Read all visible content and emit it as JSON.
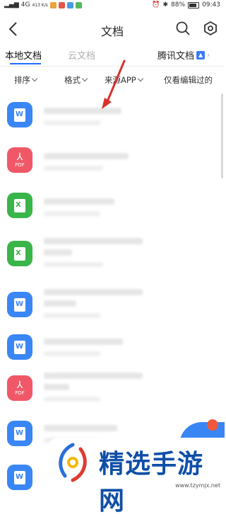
{
  "status_bar": {
    "signal_left": "4G",
    "network_speed": "413 K/s",
    "battery": "88%",
    "time": "09:43"
  },
  "header": {
    "title": "文档",
    "back_icon": "back-chevron-icon",
    "search_icon": "search-icon",
    "settings_icon": "settings-hex-icon"
  },
  "tabs": [
    {
      "label": "本地文档",
      "active": true
    },
    {
      "label": "云文档",
      "active": false
    },
    {
      "label": "腾讯文档",
      "active": false,
      "badge_icon": "tencent-docs-icon"
    }
  ],
  "filters": [
    {
      "label": "排序"
    },
    {
      "label": "格式"
    },
    {
      "label": "来源APP"
    },
    {
      "label": "仅看编辑过的"
    }
  ],
  "files": [
    {
      "type": "word",
      "type_label": "W"
    },
    {
      "type": "pdf",
      "type_label": "PDF"
    },
    {
      "type": "excel",
      "type_label": "X"
    },
    {
      "type": "excel",
      "type_label": "X"
    },
    {
      "type": "word",
      "type_label": "W"
    },
    {
      "type": "word",
      "type_label": "W"
    },
    {
      "type": "pdf",
      "type_label": "PDF"
    },
    {
      "type": "word",
      "type_label": "W"
    },
    {
      "type": "word",
      "type_label": "W"
    }
  ],
  "colors": {
    "accent": "#1f6fff",
    "word": "#3a86f5",
    "pdf": "#f05868",
    "excel": "#39b54a",
    "annotation_arrow": "#d9322e"
  },
  "watermark": {
    "title": "精选手游网",
    "url": "www.tzymjx.net"
  }
}
